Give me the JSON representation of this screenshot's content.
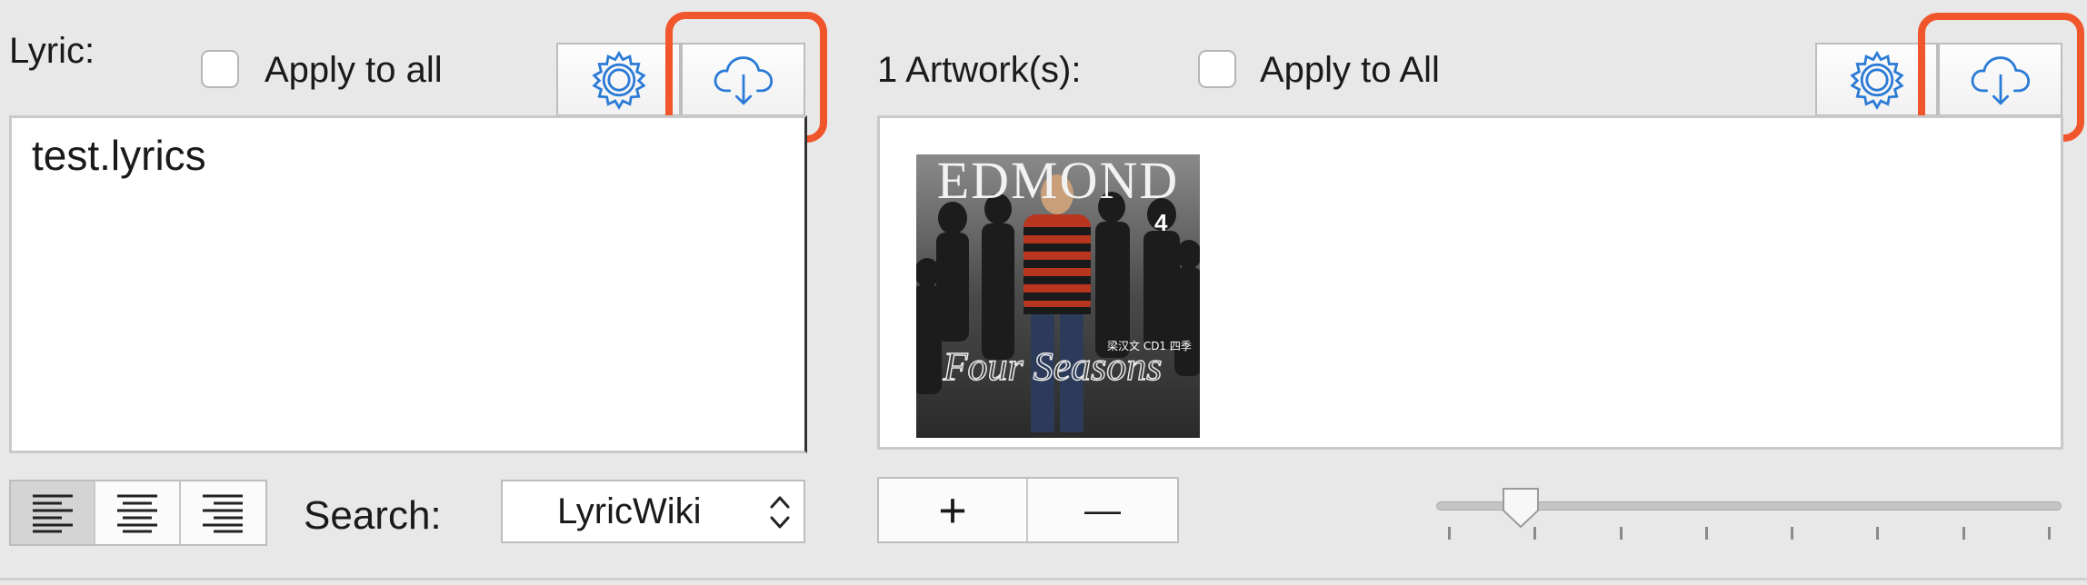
{
  "lyric": {
    "label": "Lyric:",
    "apply_all_label": "Apply to all",
    "apply_all_checked": false,
    "content": "test.lyrics",
    "search_label": "Search:",
    "search_source": "LyricWiki",
    "align_buttons": [
      "align-left",
      "align-center",
      "align-right"
    ],
    "selected_align": "align-left"
  },
  "artwork": {
    "label": "1 Artwork(s):",
    "apply_all_label": "Apply to All",
    "apply_all_checked": false,
    "add_label": "+",
    "remove_label": "—",
    "size_slider_value": 0.12,
    "slider_tick_count": 8,
    "cover": {
      "title": "EDMOND",
      "number": "4",
      "subtitle": "Four Seasons",
      "cjk_text": "梁汉文 CD1 四季"
    }
  },
  "colors": {
    "highlight": "#f0552b",
    "icon_blue": "#2b7bd6"
  }
}
